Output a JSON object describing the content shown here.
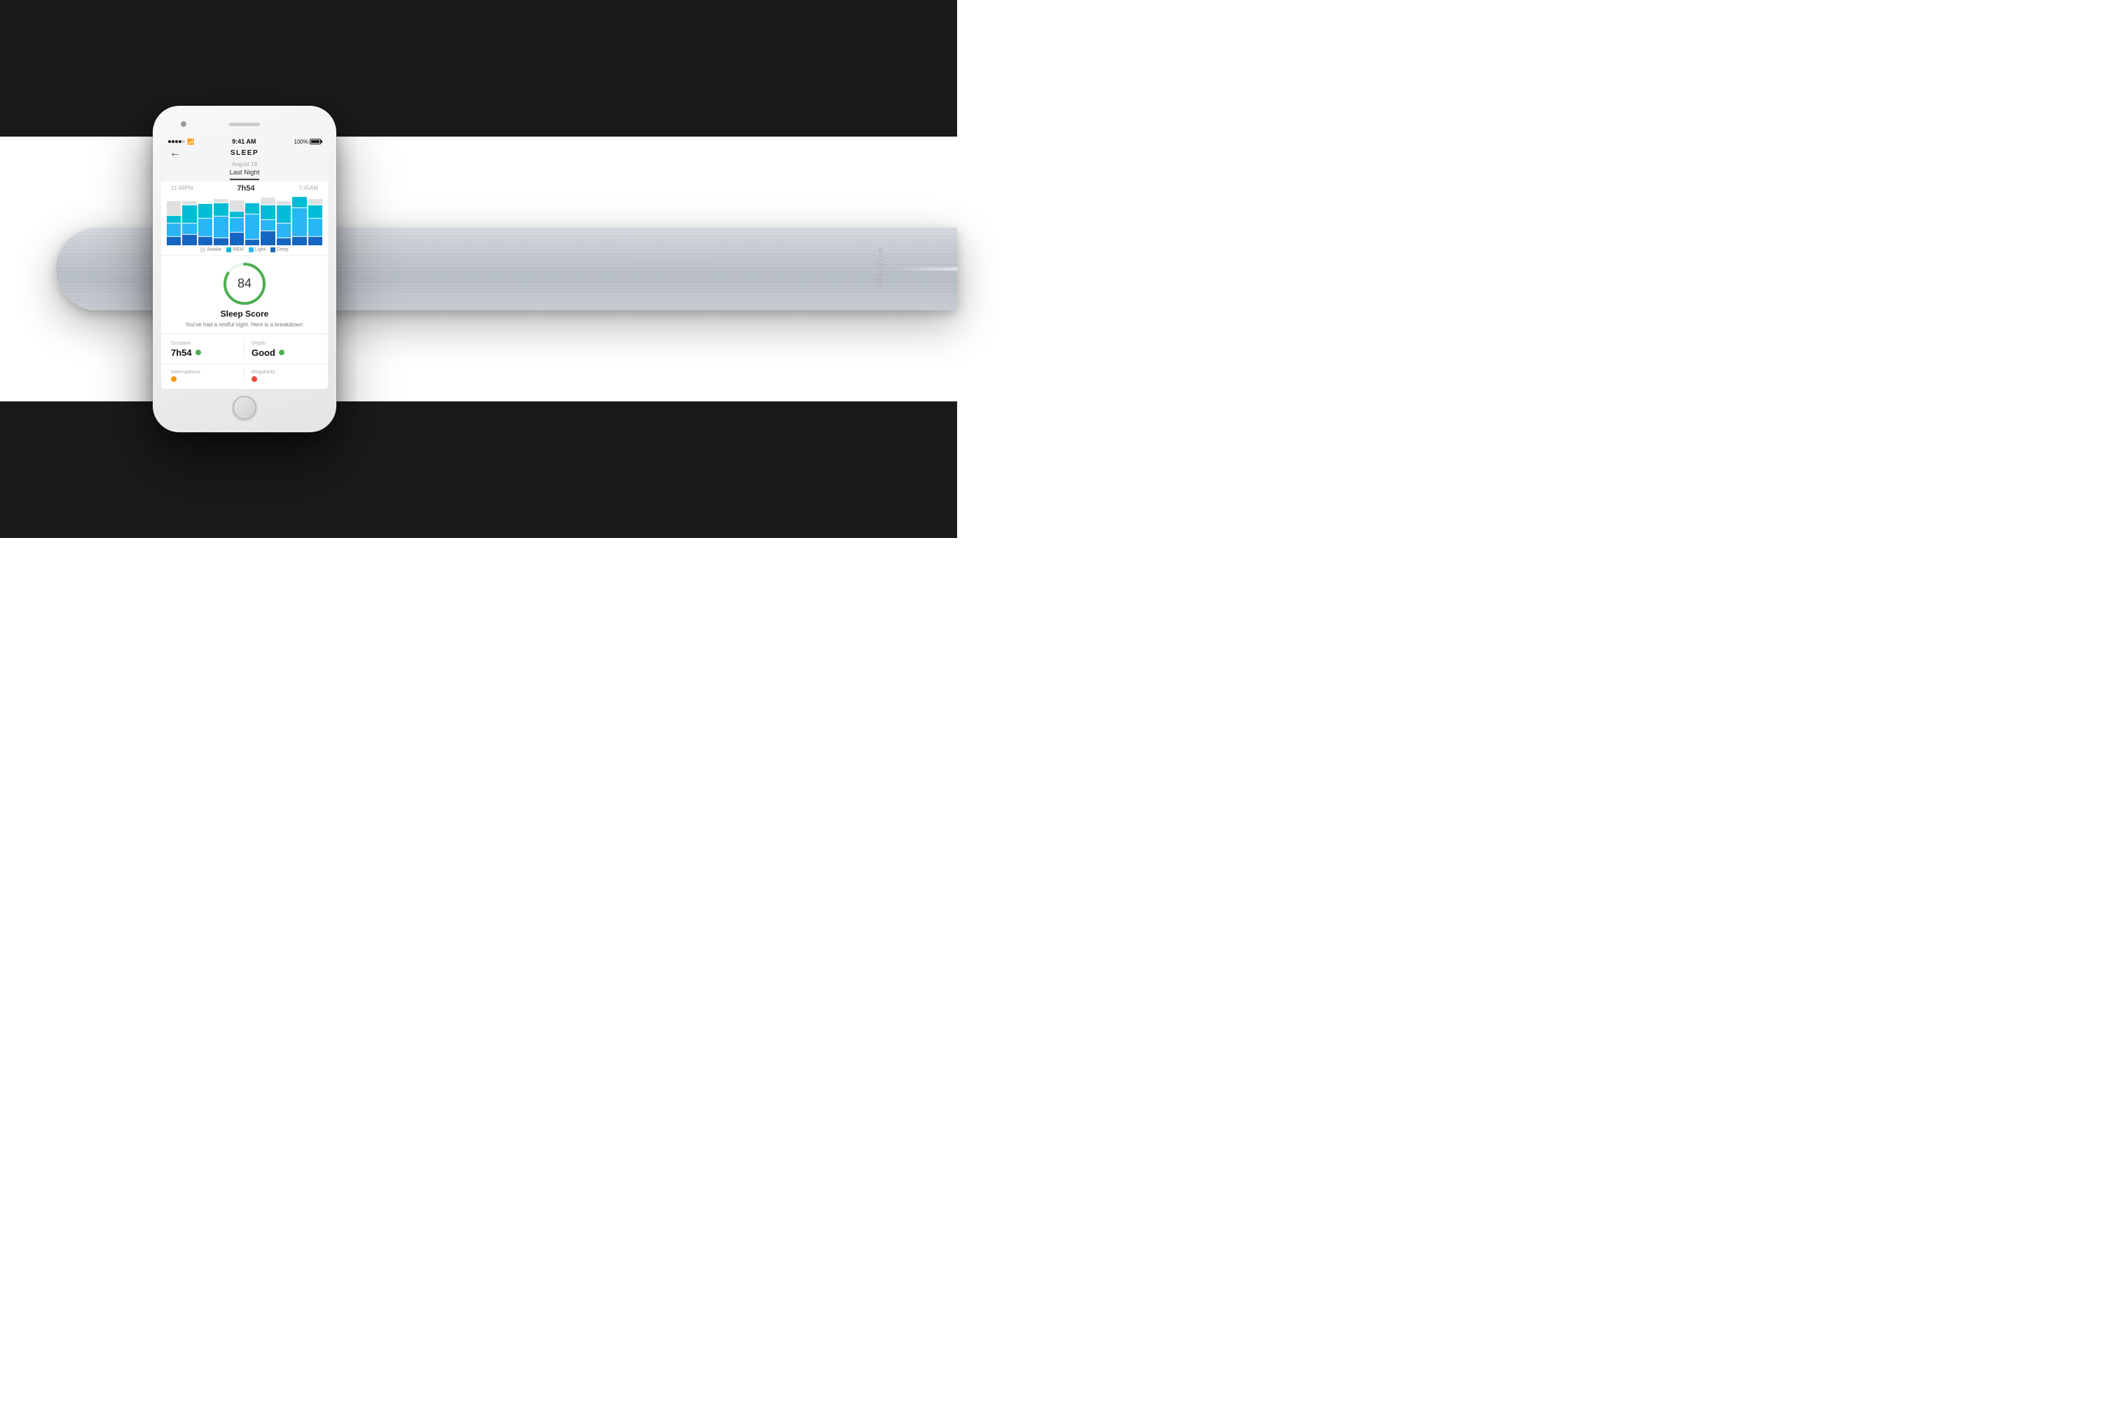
{
  "background": {
    "dark_band_top": "#1a1a1a",
    "dark_band_bottom": "#1a1a1a",
    "white_mid": "#ffffff"
  },
  "device": {
    "brand": "withings",
    "pad_color": "#c8cdd4"
  },
  "phone": {
    "status_bar": {
      "signal": "●●●●●",
      "wifi": "wifi",
      "time": "9:41 AM",
      "battery_pct": "100%"
    },
    "header": {
      "back_arrow": "←",
      "title": "SLEEP"
    },
    "date": {
      "label": "August 18",
      "tab": "Last Night"
    },
    "sleep_times": {
      "start": "11:49PM",
      "duration": "7h54",
      "end": "7:45AM"
    },
    "chart": {
      "bars": [
        {
          "awake": 20,
          "rem": 10,
          "light": 18,
          "deep": 12
        },
        {
          "awake": 5,
          "rem": 25,
          "light": 15,
          "deep": 15
        },
        {
          "awake": 0,
          "rem": 20,
          "light": 25,
          "deep": 12
        },
        {
          "awake": 5,
          "rem": 18,
          "light": 30,
          "deep": 10
        },
        {
          "awake": 15,
          "rem": 8,
          "light": 20,
          "deep": 18
        },
        {
          "awake": 0,
          "rem": 15,
          "light": 35,
          "deep": 8
        },
        {
          "awake": 10,
          "rem": 20,
          "light": 15,
          "deep": 20
        },
        {
          "awake": 5,
          "rem": 25,
          "light": 20,
          "deep": 10
        },
        {
          "awake": 0,
          "rem": 15,
          "light": 40,
          "deep": 12
        },
        {
          "awake": 8,
          "rem": 18,
          "light": 20,
          "deep": 15
        }
      ],
      "legend": {
        "awake": {
          "label": "Awake",
          "color": "#e0e0e0"
        },
        "rem": {
          "label": "REM",
          "color": "#00bcd4"
        },
        "light": {
          "label": "Light",
          "color": "#29b6f6"
        },
        "deep": {
          "label": "Deep",
          "color": "#1565c0"
        }
      }
    },
    "sleep_score": {
      "value": 84,
      "label": "Sleep Score",
      "subtitle": "You've had a restful night.\nHere is a breakdown:",
      "circle_color": "#4caf50",
      "circle_bg": "#e8f5e9",
      "progress": 0.84
    },
    "stats": {
      "duration": {
        "label": "Duration",
        "value": "7h54",
        "dot_color": "#4caf50"
      },
      "depth": {
        "label": "Depth",
        "value": "Good",
        "dot_color": "#4caf50"
      },
      "interruptions": {
        "label": "Interruptions",
        "dot_color": "#ff9800"
      },
      "regularity": {
        "label": "Regularity",
        "dot_color": "#f44336"
      }
    }
  }
}
